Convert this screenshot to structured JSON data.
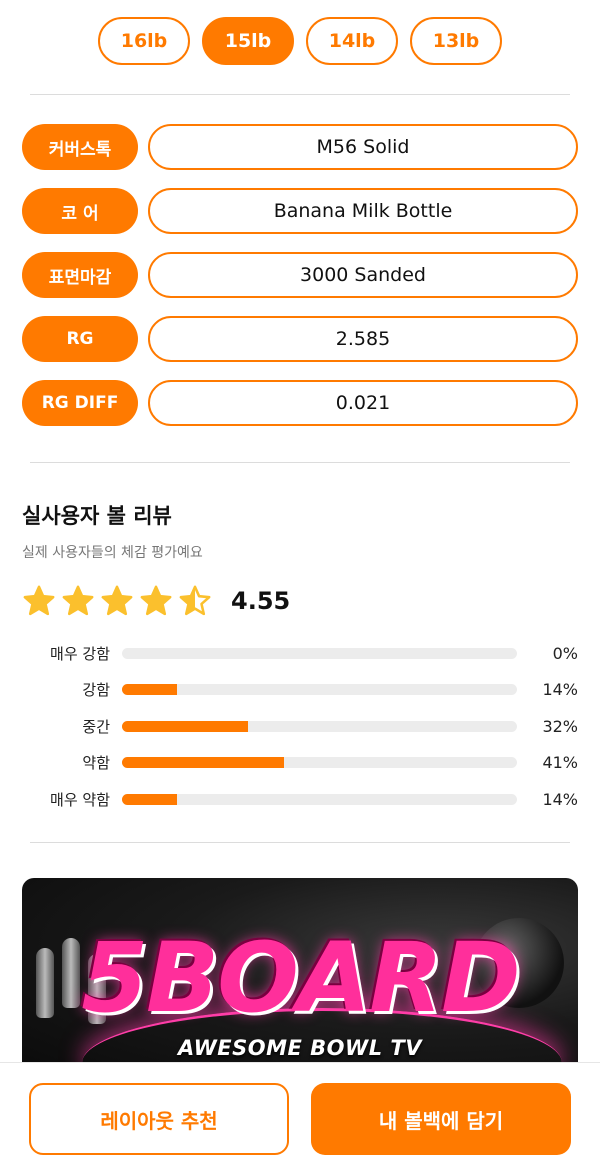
{
  "weights": {
    "options": [
      {
        "label": "16lb",
        "active": false
      },
      {
        "label": "15lb",
        "active": true
      },
      {
        "label": "14lb",
        "active": false
      },
      {
        "label": "13lb",
        "active": false
      }
    ]
  },
  "specs": [
    {
      "label": "커버스톡",
      "value": "M56 Solid"
    },
    {
      "label": "코 어",
      "value": "Banana Milk Bottle"
    },
    {
      "label": "표면마감",
      "value": "3000 Sanded"
    },
    {
      "label": "RG",
      "value": "2.585"
    },
    {
      "label": "RG DIFF",
      "value": "0.021"
    }
  ],
  "review": {
    "title": "실사용자 볼 리뷰",
    "subtitle": "실제 사용자들의 체감 평가예요",
    "rating": "4.55",
    "rating_value": 4.55,
    "star_color": "#fbc02d",
    "bars": [
      {
        "label": "매우 강함",
        "percent": "0%",
        "value": 0
      },
      {
        "label": "강함",
        "percent": "14%",
        "value": 14
      },
      {
        "label": "중간",
        "percent": "32%",
        "value": 32
      },
      {
        "label": "약함",
        "percent": "41%",
        "value": 41
      },
      {
        "label": "매우 약함",
        "percent": "14%",
        "value": 14
      }
    ]
  },
  "banner": {
    "logo_text": "5BOARD",
    "subtitle": "AWESOME BOWL TV"
  },
  "actions": {
    "layout_label": "레이아웃 추천",
    "cart_label": "내 볼백에 담기"
  },
  "colors": {
    "accent": "#ff7a00",
    "track": "#ececec"
  }
}
